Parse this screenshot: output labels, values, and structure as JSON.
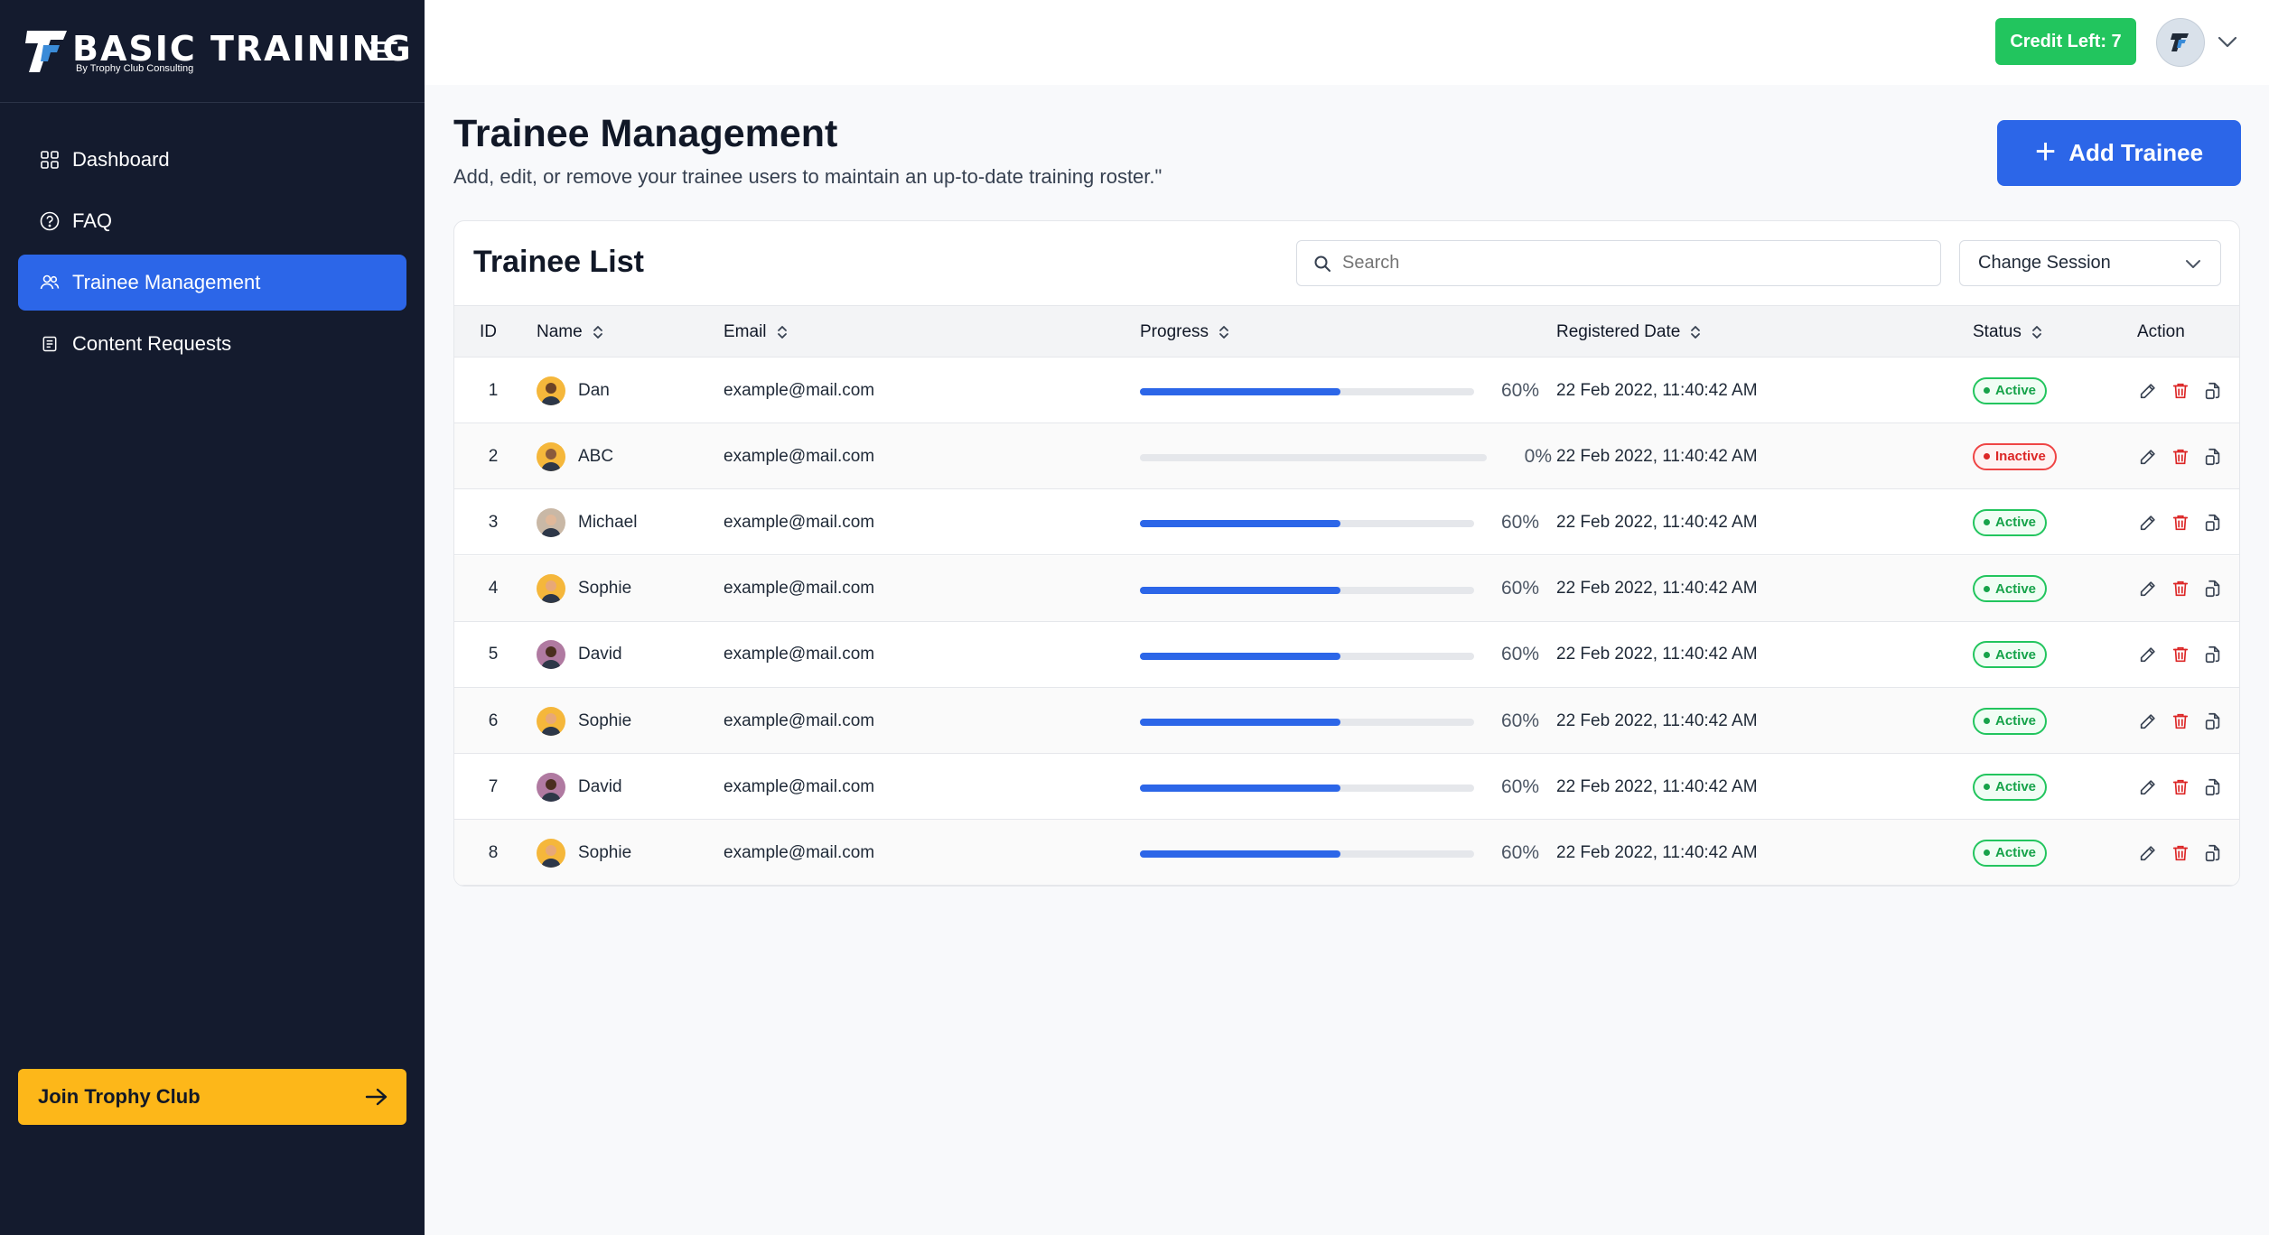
{
  "brand": {
    "title": "BASIC TRAINING",
    "subtitle": "By Trophy Club Consulting"
  },
  "sidebar": {
    "items": [
      {
        "label": "Dashboard",
        "icon": "dashboard-grid-icon",
        "active": false
      },
      {
        "label": "FAQ",
        "icon": "question-circle-icon",
        "active": false
      },
      {
        "label": "Trainee Management",
        "icon": "users-icon",
        "active": true
      },
      {
        "label": "Content Requests",
        "icon": "document-list-icon",
        "active": false
      }
    ],
    "join_label": "Join Trophy Club"
  },
  "topbar": {
    "credit_label": "Credit Left: 7"
  },
  "page": {
    "title": "Trainee Management",
    "subtitle": "Add, edit, or remove your trainee users to maintain an up-to-date training roster.\"",
    "add_button": "Add Trainee"
  },
  "list": {
    "title": "Trainee List",
    "search_placeholder": "Search",
    "session_label": "Change Session",
    "columns": {
      "id": "ID",
      "name": "Name",
      "email": "Email",
      "progress": "Progress",
      "registered": "Registered Date",
      "status": "Status",
      "action": "Action"
    },
    "rows": [
      {
        "id": "1",
        "name": "Dan",
        "email": "example@mail.com",
        "progress": 0.6,
        "progress_label": "60%",
        "date": "22 Feb 2022, 11:40:42 AM",
        "status": "Active"
      },
      {
        "id": "2",
        "name": "ABC",
        "email": "example@mail.com",
        "progress": 0,
        "progress_label": "0%",
        "date": "22 Feb 2022, 11:40:42 AM",
        "status": "Inactive"
      },
      {
        "id": "3",
        "name": "Michael",
        "email": "example@mail.com",
        "progress": 0.6,
        "progress_label": "60%",
        "date": "22 Feb 2022, 11:40:42 AM",
        "status": "Active"
      },
      {
        "id": "4",
        "name": "Sophie",
        "email": "example@mail.com",
        "progress": 0.6,
        "progress_label": "60%",
        "date": "22 Feb 2022, 11:40:42 AM",
        "status": "Active"
      },
      {
        "id": "5",
        "name": "David",
        "email": "example@mail.com",
        "progress": 0.6,
        "progress_label": "60%",
        "date": "22 Feb 2022, 11:40:42 AM",
        "status": "Active"
      },
      {
        "id": "6",
        "name": "Sophie",
        "email": "example@mail.com",
        "progress": 0.6,
        "progress_label": "60%",
        "date": "22 Feb 2022, 11:40:42 AM",
        "status": "Active"
      },
      {
        "id": "7",
        "name": "David",
        "email": "example@mail.com",
        "progress": 0.6,
        "progress_label": "60%",
        "date": "22 Feb 2022, 11:40:42 AM",
        "status": "Active"
      },
      {
        "id": "8",
        "name": "Sophie",
        "email": "example@mail.com",
        "progress": 0.6,
        "progress_label": "60%",
        "date": "22 Feb 2022, 11:40:42 AM",
        "status": "Active"
      }
    ]
  },
  "colors": {
    "sidebar": "#141b2e",
    "accent": "#2c66e8",
    "credit": "#22c55e",
    "join": "#fdb719",
    "active": "#16a34a",
    "inactive": "#dc2626"
  }
}
